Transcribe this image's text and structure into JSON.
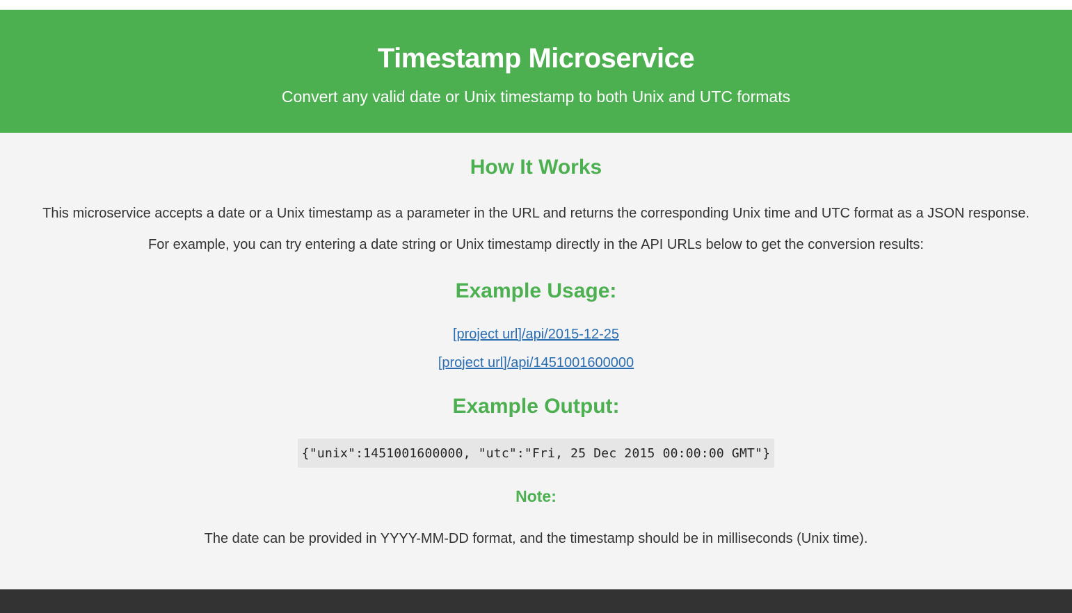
{
  "header": {
    "title": "Timestamp Microservice",
    "subtitle": "Convert any valid date or Unix timestamp to both Unix and UTC formats"
  },
  "main": {
    "how_it_works_heading": "How It Works",
    "description_1": "This microservice accepts a date or a Unix timestamp as a parameter in the URL and returns the corresponding Unix time and UTC format as a JSON response.",
    "description_2": "For example, you can try entering a date string or Unix timestamp directly in the API URLs below to get the conversion results:",
    "example_usage_heading": "Example Usage:",
    "example_links": [
      {
        "label": "[project url]/api/2015-12-25"
      },
      {
        "label": "[project url]/api/1451001600000"
      }
    ],
    "example_output_heading": "Example Output:",
    "example_output_code": "{\"unix\":1451001600000, \"utc\":\"Fri, 25 Dec 2015 00:00:00 GMT\"}",
    "note_heading": "Note:",
    "note_text": "The date can be provided in YYYY-MM-DD format, and the timestamp should be in milliseconds (Unix time)."
  },
  "colors": {
    "accent": "#4caf50",
    "link": "#2a6db0",
    "footer": "#333333",
    "background": "#f4f4f4"
  }
}
